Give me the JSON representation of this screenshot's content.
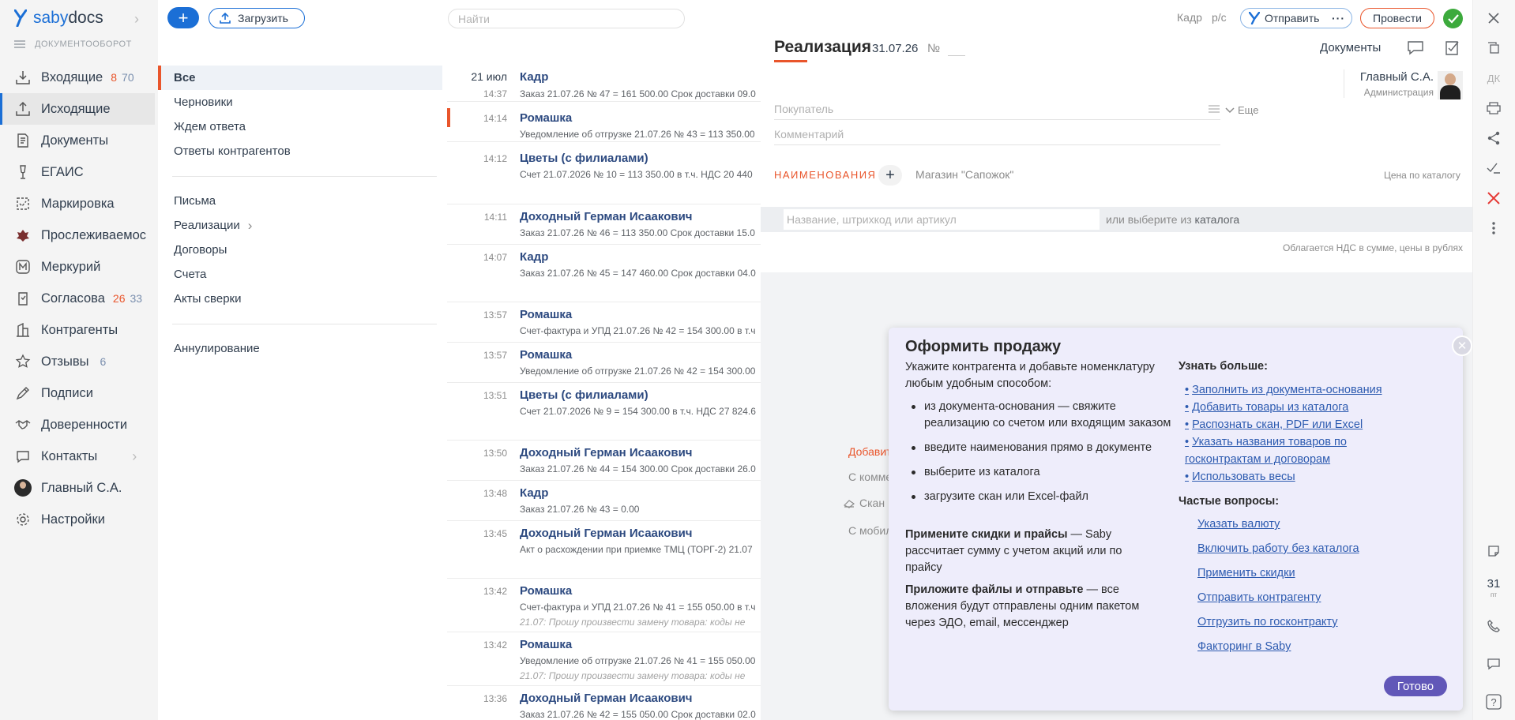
{
  "app": {
    "logo_part1": "saby",
    "logo_part2": "docs"
  },
  "nav": {
    "section_title": "ДОКУМЕНТООБОРОТ",
    "items": [
      {
        "label": "Входящие",
        "count_red": "8",
        "count_blue": "70",
        "icon": "inbox-icon"
      },
      {
        "label": "Исходящие",
        "icon": "outbox-icon",
        "active": true
      },
      {
        "label": "Документы",
        "icon": "documents-icon"
      },
      {
        "label": "ЕГАИС",
        "icon": "egais-icon"
      },
      {
        "label": "Маркировка",
        "icon": "marking-icon"
      },
      {
        "label": "Прослеживаемос",
        "icon": "traceability-icon"
      },
      {
        "label": "Меркурий",
        "icon": "mercury-icon"
      },
      {
        "label": "Согласова",
        "count_red": "26",
        "count_blue": "33",
        "icon": "approval-icon"
      },
      {
        "label": "Контрагенты",
        "icon": "counterparties-icon"
      },
      {
        "label": "Отзывы",
        "count_blue": "6",
        "icon": "star-icon"
      },
      {
        "label": "Подписи",
        "icon": "signature-icon"
      },
      {
        "label": "Доверенности",
        "icon": "handshake-icon"
      },
      {
        "label": "Контакты",
        "icon": "contacts-icon"
      },
      {
        "label": "Главный С.А.",
        "icon": "avatar"
      },
      {
        "label": "Настройки",
        "icon": "gear-icon"
      }
    ]
  },
  "toolbar": {
    "upload_label": "Загрузить",
    "search_placeholder": "Найти"
  },
  "folders": {
    "group1": [
      "Все",
      "Черновики",
      "Ждем ответа",
      "Ответы контрагентов"
    ],
    "group2": [
      "Письма",
      "Реализации",
      "Договоры",
      "Счета",
      "Акты сверки"
    ],
    "group3": [
      "Аннулирование"
    ]
  },
  "list": {
    "date": "21 июл",
    "rows": [
      {
        "time": "14:37",
        "title": "Кадр",
        "sub": "Заказ 21.07.26 № 47 = 161 500.00 Срок доставки 09.0"
      },
      {
        "time": "14:14",
        "title": "Ромашка",
        "sub": "Уведомление об отгрузке 21.07.26 № 43 = 113 350.00"
      },
      {
        "time": "14:12",
        "title": "Цветы (с филиалами)",
        "sub": "Счет 21.07.2026 № 10 = 113 350.00 в т.ч. НДС 20 440"
      },
      {
        "time": "14:11",
        "title": "Доходный Герман Исаакович",
        "sub": "Заказ 21.07.26 № 46 = 113 350.00 Срок доставки 15.0"
      },
      {
        "time": "14:07",
        "title": "Кадр",
        "sub": "Заказ 21.07.26 № 45 = 147 460.00 Срок доставки 04.0"
      },
      {
        "time": "13:57",
        "title": "Ромашка",
        "sub": "Счет-фактура и УПД 21.07.26 № 42 = 154 300.00 в т.ч"
      },
      {
        "time": "13:57",
        "title": "Ромашка",
        "sub": "Уведомление об отгрузке 21.07.26 № 42 = 154 300.00"
      },
      {
        "time": "13:51",
        "title": "Цветы (с филиалами)",
        "sub": "Счет 21.07.2026 № 9 = 154 300.00 в т.ч. НДС 27 824.6"
      },
      {
        "time": "13:50",
        "title": "Доходный Герман Исаакович",
        "sub": "Заказ 21.07.26 № 44 = 154 300.00 Срок доставки 26.0"
      },
      {
        "time": "13:48",
        "title": "Кадр",
        "sub": "Заказ 21.07.26 № 43 = 0.00"
      },
      {
        "time": "13:45",
        "title": "Доходный Герман Исаакович",
        "sub": "Акт о расхождении при приемке ТМЦ (ТОРГ-2) 21.07"
      },
      {
        "time": "13:42",
        "title": "Ромашка",
        "sub": "Счет-фактура и УПД 21.07.26 № 41 = 155 050.00 в т.ч",
        "note": "21.07: Прошу произвести замену товара: коды не"
      },
      {
        "time": "13:42",
        "title": "Ромашка",
        "sub": "Уведомление об отгрузке 21.07.26 № 41 = 155 050.00",
        "note": "21.07: Прошу произвести замену товара: коды не"
      },
      {
        "time": "13:36",
        "title": "Доходный Герман Исаакович",
        "sub": "Заказ 21.07.26 № 42 = 155 050.00 Срок доставки 02.0"
      }
    ]
  },
  "doc": {
    "title": "Реализация",
    "date": "31.07.26",
    "number_label": "№",
    "kadr_link": "Кадр",
    "rs_link": "р/с",
    "send_label": "Отправить",
    "send_more": "···",
    "conduct_label": "Провести",
    "documents_link": "Документы",
    "responsible_name": "Главный С.А.",
    "responsible_role": "Администрация",
    "buyer_placeholder": "Покупатель",
    "more_label": "Еще",
    "comment_placeholder": "Комментарий",
    "section_names": "НАИМЕНОВАНИЯ",
    "store": "Магазин \"Сапожок\"",
    "price_by_catalog": "Цена по каталогу",
    "name_input_placeholder": "Название, штрихкод или артикул",
    "or_select_prefix": "или выберите из",
    "or_select_catalog": "каталога",
    "vat_note": "Облагается НДС в сумме, цены в рублях",
    "side_actions": [
      "Добавить",
      "С комментарием",
      "Скан",
      "С мобильного"
    ]
  },
  "popup": {
    "title": "Оформить продажу",
    "intro": "Укажите контрагента и добавьте номенклатуру любым удобным способом:",
    "bullets": [
      "из документа-основания — свяжите реализацию со счетом или входящим заказом",
      "введите наименования прямо в документе",
      "выберите из каталога",
      "загрузите скан или Excel-файл"
    ],
    "discounts_bold": "Примените скидки и прайсы",
    "discounts_text": " — Saby рассчитает сумму с учетом акций или по прайсу",
    "files_bold": "Приложите файлы и отправьте",
    "files_text": " — все вложения будут отправлены одним пакетом через ЭДО, email, мессенджер",
    "learn_more": "Узнать больше:",
    "learn_links": [
      "Заполнить из документа-основания",
      "Добавить товары из каталога",
      "Распознать скан, PDF или Excel",
      "Указать названия товаров по госконтрактам и договорам",
      "Использовать весы"
    ],
    "faq_title": "Частые вопросы:",
    "faq_links": [
      "Указать валюту",
      "Включить работу без каталога",
      "Применить скидки",
      "Отправить контрагенту",
      "Отгрузить по госконтракту",
      "Факторинг в Saby"
    ],
    "done_label": "Готово"
  },
  "rightbar": {
    "dk_label": "ДК",
    "calendar_day": "31",
    "calendar_weekday": "пт",
    "help": "?"
  },
  "colors": {
    "accent": "#1b6fd6",
    "brand_orange": "#e9552b",
    "success": "#3caa3c",
    "popup_bg": "#eeedfb",
    "popup_button": "#6157b8"
  }
}
